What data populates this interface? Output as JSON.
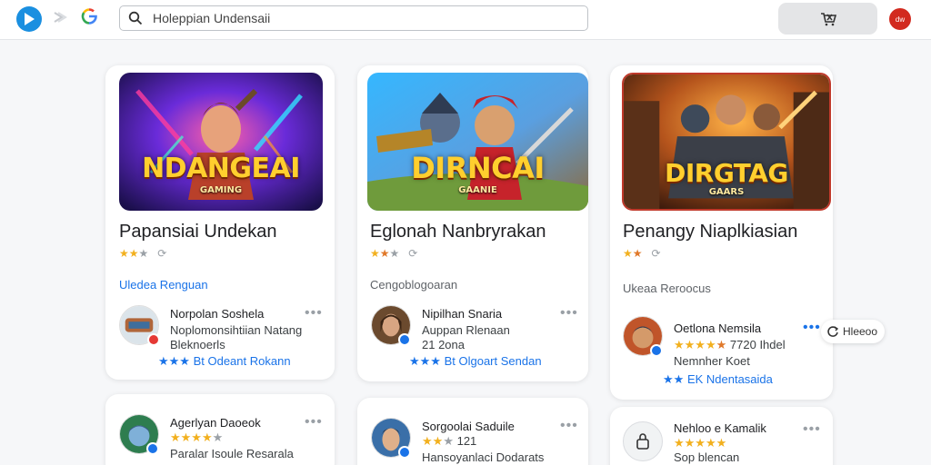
{
  "header": {
    "search_text": "Holeppian Undensaii",
    "badge_text": "dw"
  },
  "colors": {
    "accent_blue": "#1a73e8",
    "play_blue": "#1a8fe0",
    "star_gold": "#f2b01e",
    "avatar_red": "#d22a1f"
  },
  "cards": [
    {
      "banner_title": "NDANGEAI",
      "banner_sub": "GAMING",
      "title": "Papansiai Undekan",
      "section_label": "Uledea Renguan",
      "section_color": "#1a73e8",
      "review": {
        "name": "Norpolan Soshela",
        "line1": "Noplomonsihtiian Natang",
        "line2": "Bleknoerls",
        "footer": "Bt Odeant Rokann"
      }
    },
    {
      "banner_title": "DIRNCAI",
      "banner_sub": "GAANIE",
      "title": "Eglonah Nanbryrakan",
      "section_label": "Cengoblogoaran",
      "section_color": "#5f6368",
      "review": {
        "name": "Nipilhan Snaria",
        "line1": "Auppan Rlenaan",
        "line2": "21 2ona",
        "footer": "Bt Olgoart Sendan"
      }
    },
    {
      "banner_title": "DIRGTAG",
      "banner_sub": "GAARS",
      "title": "Penangy Niaplkiasian",
      "section_label": "Ukeaa Reroocus",
      "section_color": "#5f6368",
      "review": {
        "name": "Oetlona Nemsila",
        "rating_text": "7720 Ihdel",
        "line2": "Nemnher Koet",
        "footer": "EK Ndentasaida"
      },
      "floating_tag": "Hleeoo"
    }
  ],
  "lower_cards": [
    {
      "name": "Agerlyan Daoeok",
      "line1": "Paralar Isoule Resarala"
    },
    {
      "name": "Sorgoolai Saduile",
      "rating_text": "121",
      "line1": "Hansoyanlaci Dodarats"
    },
    {
      "name": "Nehloo e Kamalik",
      "line1": "Sop blencan"
    }
  ],
  "icons": {
    "logo": "play-logo-icon",
    "search": "search-icon",
    "cart": "cart-icon",
    "more": "more-dots-icon",
    "lock": "lock-icon"
  }
}
